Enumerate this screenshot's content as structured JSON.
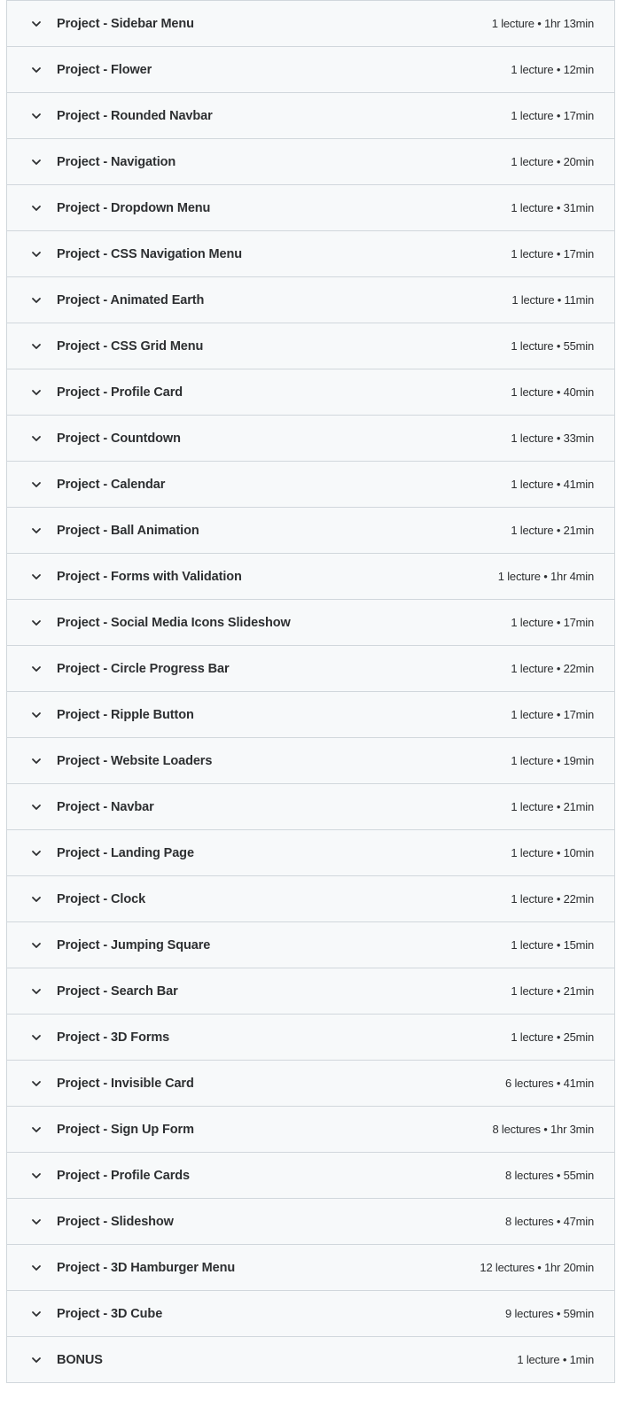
{
  "curriculum": {
    "sections": [
      {
        "title": "Project - Sidebar Menu",
        "meta": "1 lecture • 1hr 13min"
      },
      {
        "title": "Project - Flower",
        "meta": "1 lecture • 12min"
      },
      {
        "title": "Project - Rounded Navbar",
        "meta": "1 lecture • 17min"
      },
      {
        "title": "Project - Navigation",
        "meta": "1 lecture • 20min"
      },
      {
        "title": "Project - Dropdown Menu",
        "meta": "1 lecture • 31min"
      },
      {
        "title": "Project - CSS Navigation Menu",
        "meta": "1 lecture • 17min"
      },
      {
        "title": "Project - Animated Earth",
        "meta": "1 lecture • 11min"
      },
      {
        "title": "Project - CSS Grid Menu",
        "meta": "1 lecture • 55min"
      },
      {
        "title": "Project - Profile Card",
        "meta": "1 lecture • 40min"
      },
      {
        "title": "Project - Countdown",
        "meta": "1 lecture • 33min"
      },
      {
        "title": "Project - Calendar",
        "meta": "1 lecture • 41min"
      },
      {
        "title": "Project - Ball Animation",
        "meta": "1 lecture • 21min"
      },
      {
        "title": "Project - Forms with Validation",
        "meta": "1 lecture • 1hr 4min"
      },
      {
        "title": "Project - Social Media Icons Slideshow",
        "meta": "1 lecture • 17min"
      },
      {
        "title": "Project - Circle Progress Bar",
        "meta": "1 lecture • 22min"
      },
      {
        "title": "Project - Ripple Button",
        "meta": "1 lecture • 17min"
      },
      {
        "title": "Project - Website Loaders",
        "meta": "1 lecture • 19min"
      },
      {
        "title": "Project - Navbar",
        "meta": "1 lecture • 21min"
      },
      {
        "title": "Project - Landing Page",
        "meta": "1 lecture • 10min"
      },
      {
        "title": "Project - Clock",
        "meta": "1 lecture • 22min"
      },
      {
        "title": "Project - Jumping Square",
        "meta": "1 lecture • 15min"
      },
      {
        "title": "Project - Search Bar",
        "meta": "1 lecture • 21min"
      },
      {
        "title": "Project - 3D Forms",
        "meta": "1 lecture • 25min"
      },
      {
        "title": "Project - Invisible Card",
        "meta": "6 lectures • 41min"
      },
      {
        "title": "Project - Sign Up Form",
        "meta": "8 lectures • 1hr 3min"
      },
      {
        "title": "Project - Profile Cards",
        "meta": "8 lectures • 55min"
      },
      {
        "title": "Project - Slideshow",
        "meta": "8 lectures • 47min"
      },
      {
        "title": "Project - 3D Hamburger Menu",
        "meta": "12 lectures • 1hr 20min"
      },
      {
        "title": "Project - 3D Cube",
        "meta": "9 lectures • 59min"
      },
      {
        "title": "BONUS",
        "meta": "1 lecture • 1min"
      }
    ],
    "expand_icon": "chevron-down-icon"
  }
}
